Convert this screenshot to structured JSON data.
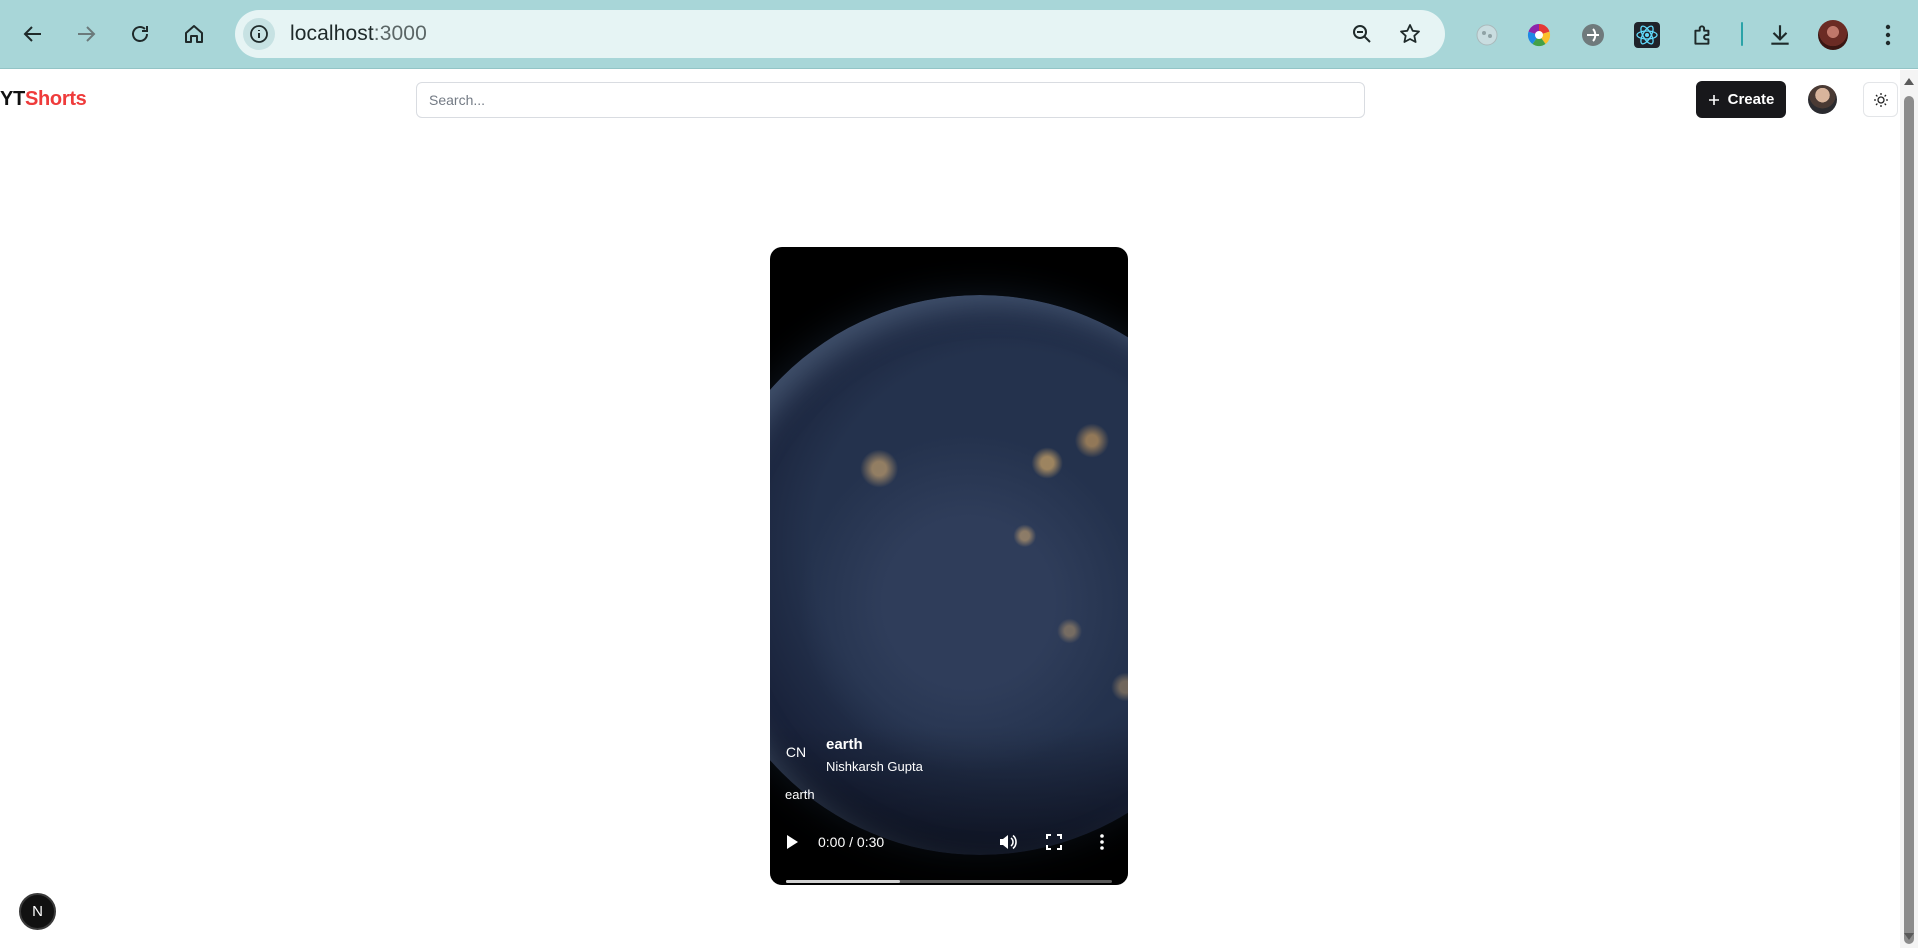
{
  "browser": {
    "url_host": "localhost",
    "url_port": ":3000",
    "extensions": [
      "extension-icon",
      "color-picker-extension-icon",
      "grey-extension-icon",
      "react-devtools-icon",
      "puzzle-extensions-icon"
    ]
  },
  "app": {
    "logo_yt": "YT",
    "logo_shorts": "Shorts",
    "search_placeholder": "Search...",
    "create_label": "Create",
    "brand_color": "#ef3b3b",
    "button_color": "#18181b"
  },
  "video": {
    "channel_initials": "CN",
    "title": "earth",
    "channel_name": "Nishkarsh Gupta",
    "tag": "earth",
    "time_display": "0:00 / 0:30",
    "progress": 0.35
  },
  "dev_badge": {
    "label": "N"
  }
}
